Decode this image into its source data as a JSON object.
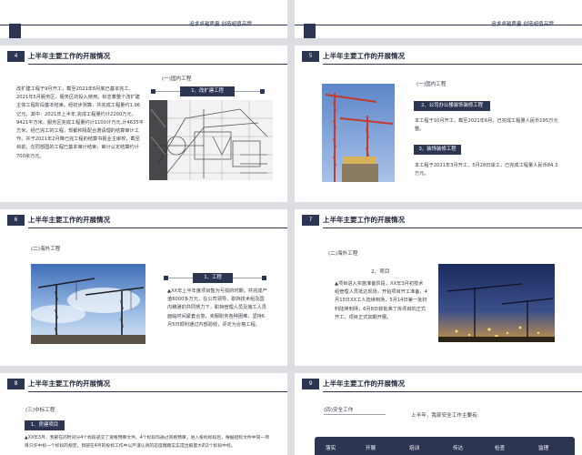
{
  "top": {
    "slogan_left": "追求卓越质量  创造超值品牌",
    "slogan_right": "追求卓越质量  创造超值品牌"
  },
  "slides": [
    {
      "num": "4",
      "title": "上半年主要工作的开展情况",
      "subtitle": "(一)国内工程",
      "label": "1、改扩建工程",
      "body": "改扩建工程于9月开工，截至2021年6月底已基本完工，2021年5月服务区，服务区的投入使用。标志着整个改扩建主体工程阶段基本结束。经初步测算，共完成工程量约1.96亿元。其中：2021年上半年,完成工程量约计2200万元，9421平方米。服务区完成工程量约计1100计万元,计4635平方米，经已完工的工程，现都积极配合邀请理的结算审计工作。并于2021年2月降已完工程的结算书报业主审校，截至目前，在同部国的工程已基本审计结束，审计认定结算约计700余万元。"
    },
    {
      "num": "5",
      "title": "上半年主要工作的开展情况",
      "subtitle": "(一)国内工程",
      "label2": "2、公司办公楼装饰装修工程",
      "body2": "本工程于10月开工，截至2021年6月，已完成工程量人民币195万元整。",
      "label3": "3、装饰装修工程",
      "body3": "本工程于2021年3月开工，5月28日竣工，已完成工程量人民币84.3万元。"
    },
    {
      "num": "6",
      "title": "上半年主要工作的开展情况",
      "subtitle": "(二)海外工程",
      "label": "1、工程",
      "body": "▲XX年上半年度项目暂为亏损的时期，共完成产值6000多万元，在公司领导、职挡技术组及国内精通的共同努力下，职挡管理人员及施工人员面临时间紧套合意，克服职务各种困难，坚持6月5日顺利通过内部验收，评定为合格工程。"
    },
    {
      "num": "7",
      "title": "上半年主要工作的开展情况",
      "subtitle": "(二)海外工程",
      "heading": "2、项目",
      "body": "▲项目进入实施准备阶段，XX年3月初技术组管理人员抵达现场，开始项目开工准备，4月15日XX工人陆续到场，5月14日第一批材料陆续到场，6月8日获批准了拆项目的正式开工，项目正式如期开展。"
    },
    {
      "num": "8",
      "title": "上半年主要工作的开展情况",
      "subtitle": "(三)中标工程",
      "label": "1、房建项目",
      "body": "▲XX年3月，我部在的时间分4个标段递交了资格预审文件。4个标段均通过资格预审。进入投标标段后，根据招标文件中同一项目只许中标一个标段的规定，我部在4月的投标工作中以严谨认真的态度踏踏实实提出报量大的2个标段中标。"
    },
    {
      "num": "9",
      "title": "上半年主要工作的开展情况",
      "subtitle": "(四)安全工作",
      "intro": "上半年，我部安全工作主要有:",
      "headers": [
        "落实",
        "开展",
        "培训",
        "传达",
        "检查",
        "监理"
      ]
    }
  ]
}
